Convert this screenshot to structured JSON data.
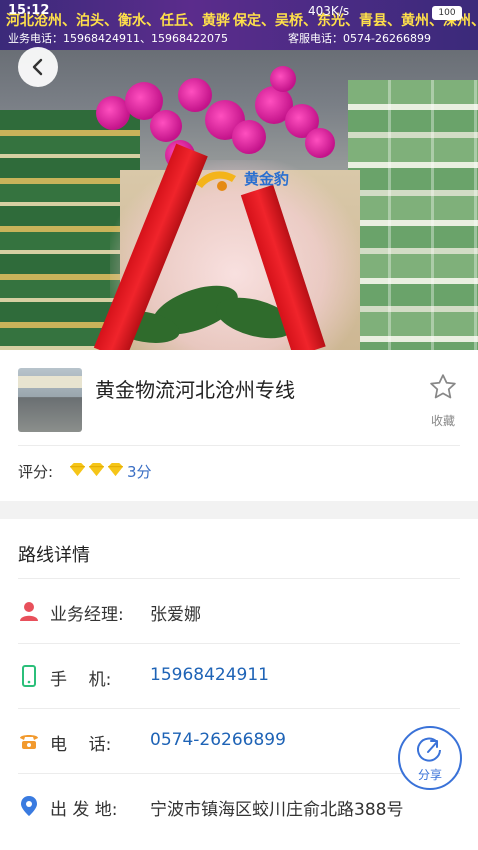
{
  "status_bar": {
    "time": "15:12",
    "network": "403K/s",
    "battery": "100"
  },
  "hero": {
    "banner_line1_left": "河北沧州、泊头、衡水、任丘、黄骅",
    "banner_line1_right": "保定、吴桥、东光、青县、黄州、深州、沧",
    "banner_line2_left": "业务电话：15968424911、15968422075",
    "banner_line2_right": "客服电话：0574-26266899",
    "logo_text": "黄金豹"
  },
  "company": {
    "name": "黄金物流河北沧州专线",
    "favorite_label": "收藏",
    "rating_label": "评分:",
    "rating_gems": 3,
    "rating_score": "3分"
  },
  "route": {
    "section_title": "路线详情",
    "rows": [
      {
        "label": "业务经理:",
        "value": "张爱娜",
        "icon": "person-icon"
      },
      {
        "label": "手    机:",
        "value": "15968424911",
        "icon": "mobile-phone-icon"
      },
      {
        "label": "电    话:",
        "value": "0574-26266899",
        "icon": "telephone-icon"
      },
      {
        "label": "出 发 地:",
        "value": "宁波市镇海区蛟川庄俞北路388号",
        "icon": "location-pin-icon"
      }
    ]
  },
  "share_label": "分享",
  "colors": {
    "accent_blue": "#1e63b6",
    "gem_yellow": "#f5c518",
    "person_red": "#e8505b",
    "mobile_green": "#2bbf7a",
    "phone_orange": "#f29a2e",
    "pin_blue": "#3a7be0"
  }
}
